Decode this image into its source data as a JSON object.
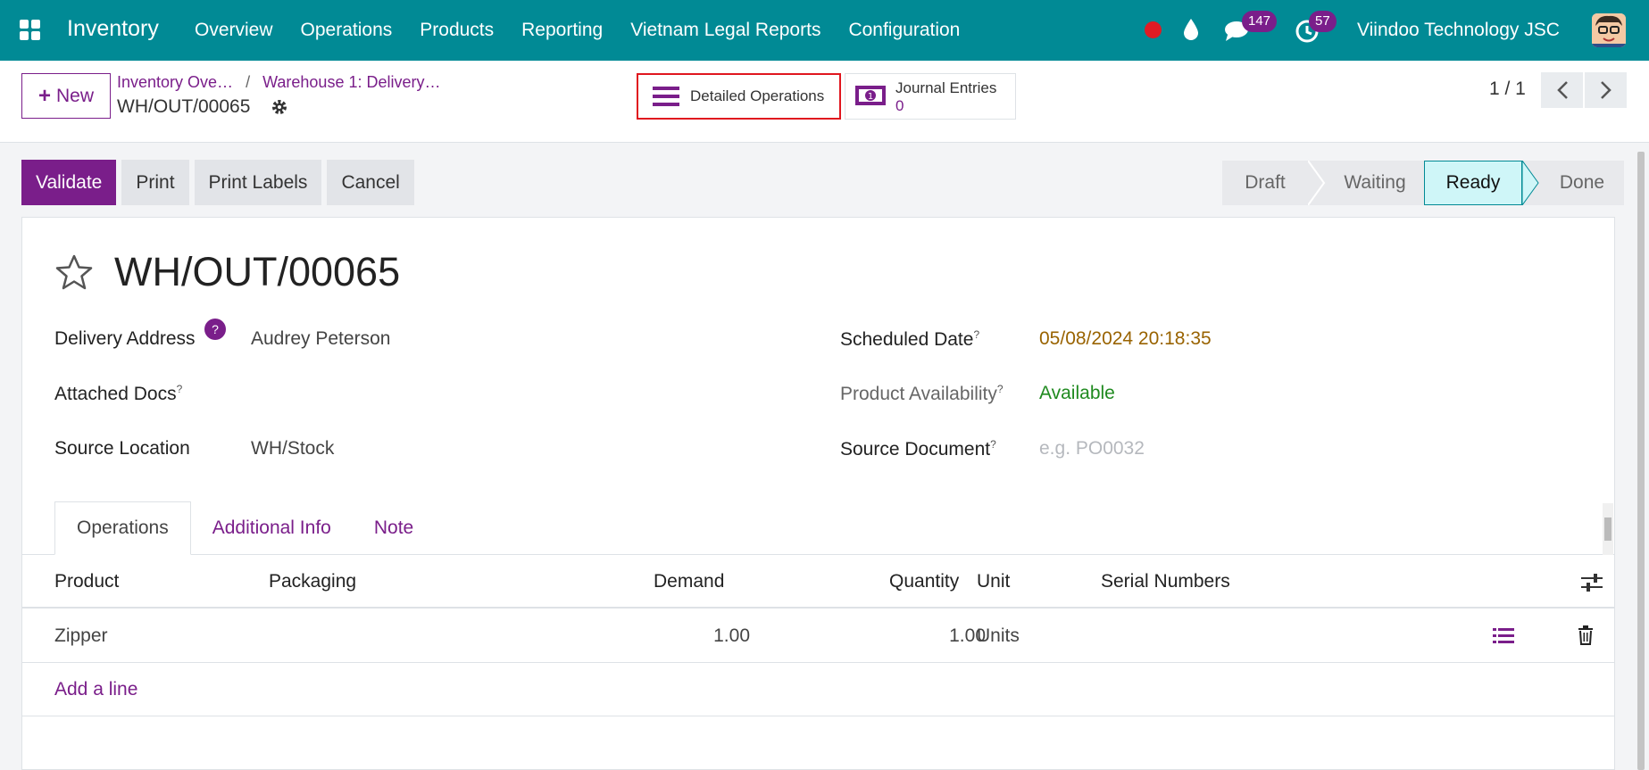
{
  "navbar": {
    "app_name": "Inventory",
    "menu": [
      "Overview",
      "Operations",
      "Products",
      "Reporting",
      "Vietnam Legal Reports",
      "Configuration"
    ],
    "messages_count": "147",
    "activities_count": "57",
    "company": "Viindoo Technology JSC"
  },
  "control": {
    "new_label": "New",
    "breadcrumb": [
      "Inventory Ove…",
      "Warehouse 1: Delivery…"
    ],
    "breadcrumb_sep": "/",
    "record_name": "WH/OUT/00065",
    "smart_buttons": {
      "detailed_ops": "Detailed Operations",
      "journal_label": "Journal Entries",
      "journal_count": "0"
    },
    "pager": "1 / 1"
  },
  "actions": [
    "Validate",
    "Print",
    "Print Labels",
    "Cancel"
  ],
  "statusbar": [
    "Draft",
    "Waiting",
    "Ready",
    "Done"
  ],
  "form": {
    "title": "WH/OUT/00065",
    "delivery_address_label": "Delivery Address",
    "delivery_address_help": "?",
    "delivery_address": "Audrey Peterson",
    "attached_docs_label": "Attached Docs",
    "source_location_label": "Source Location",
    "source_location": "WH/Stock",
    "scheduled_date_label": "Scheduled Date",
    "scheduled_date": "05/08/2024 20:18:35",
    "availability_label": "Product Availability",
    "availability": "Available",
    "source_document_label": "Source Document",
    "source_document_placeholder": "e.g. PO0032",
    "help_mark": "?"
  },
  "tabs": [
    "Operations",
    "Additional Info",
    "Note"
  ],
  "table": {
    "headers": [
      "Product",
      "Packaging",
      "Demand",
      "Quantity",
      "Unit",
      "Serial Numbers"
    ],
    "rows": [
      {
        "product": "Zipper",
        "packaging": "",
        "demand": "1.00",
        "quantity": "1.00",
        "unit": "Units",
        "serials": ""
      }
    ],
    "add_line": "Add a line"
  },
  "colors": {
    "navbar": "#018a95",
    "primary": "#7a1e8a",
    "highlight_border": "#e0161e",
    "ready_stage": "#cff6f8"
  }
}
